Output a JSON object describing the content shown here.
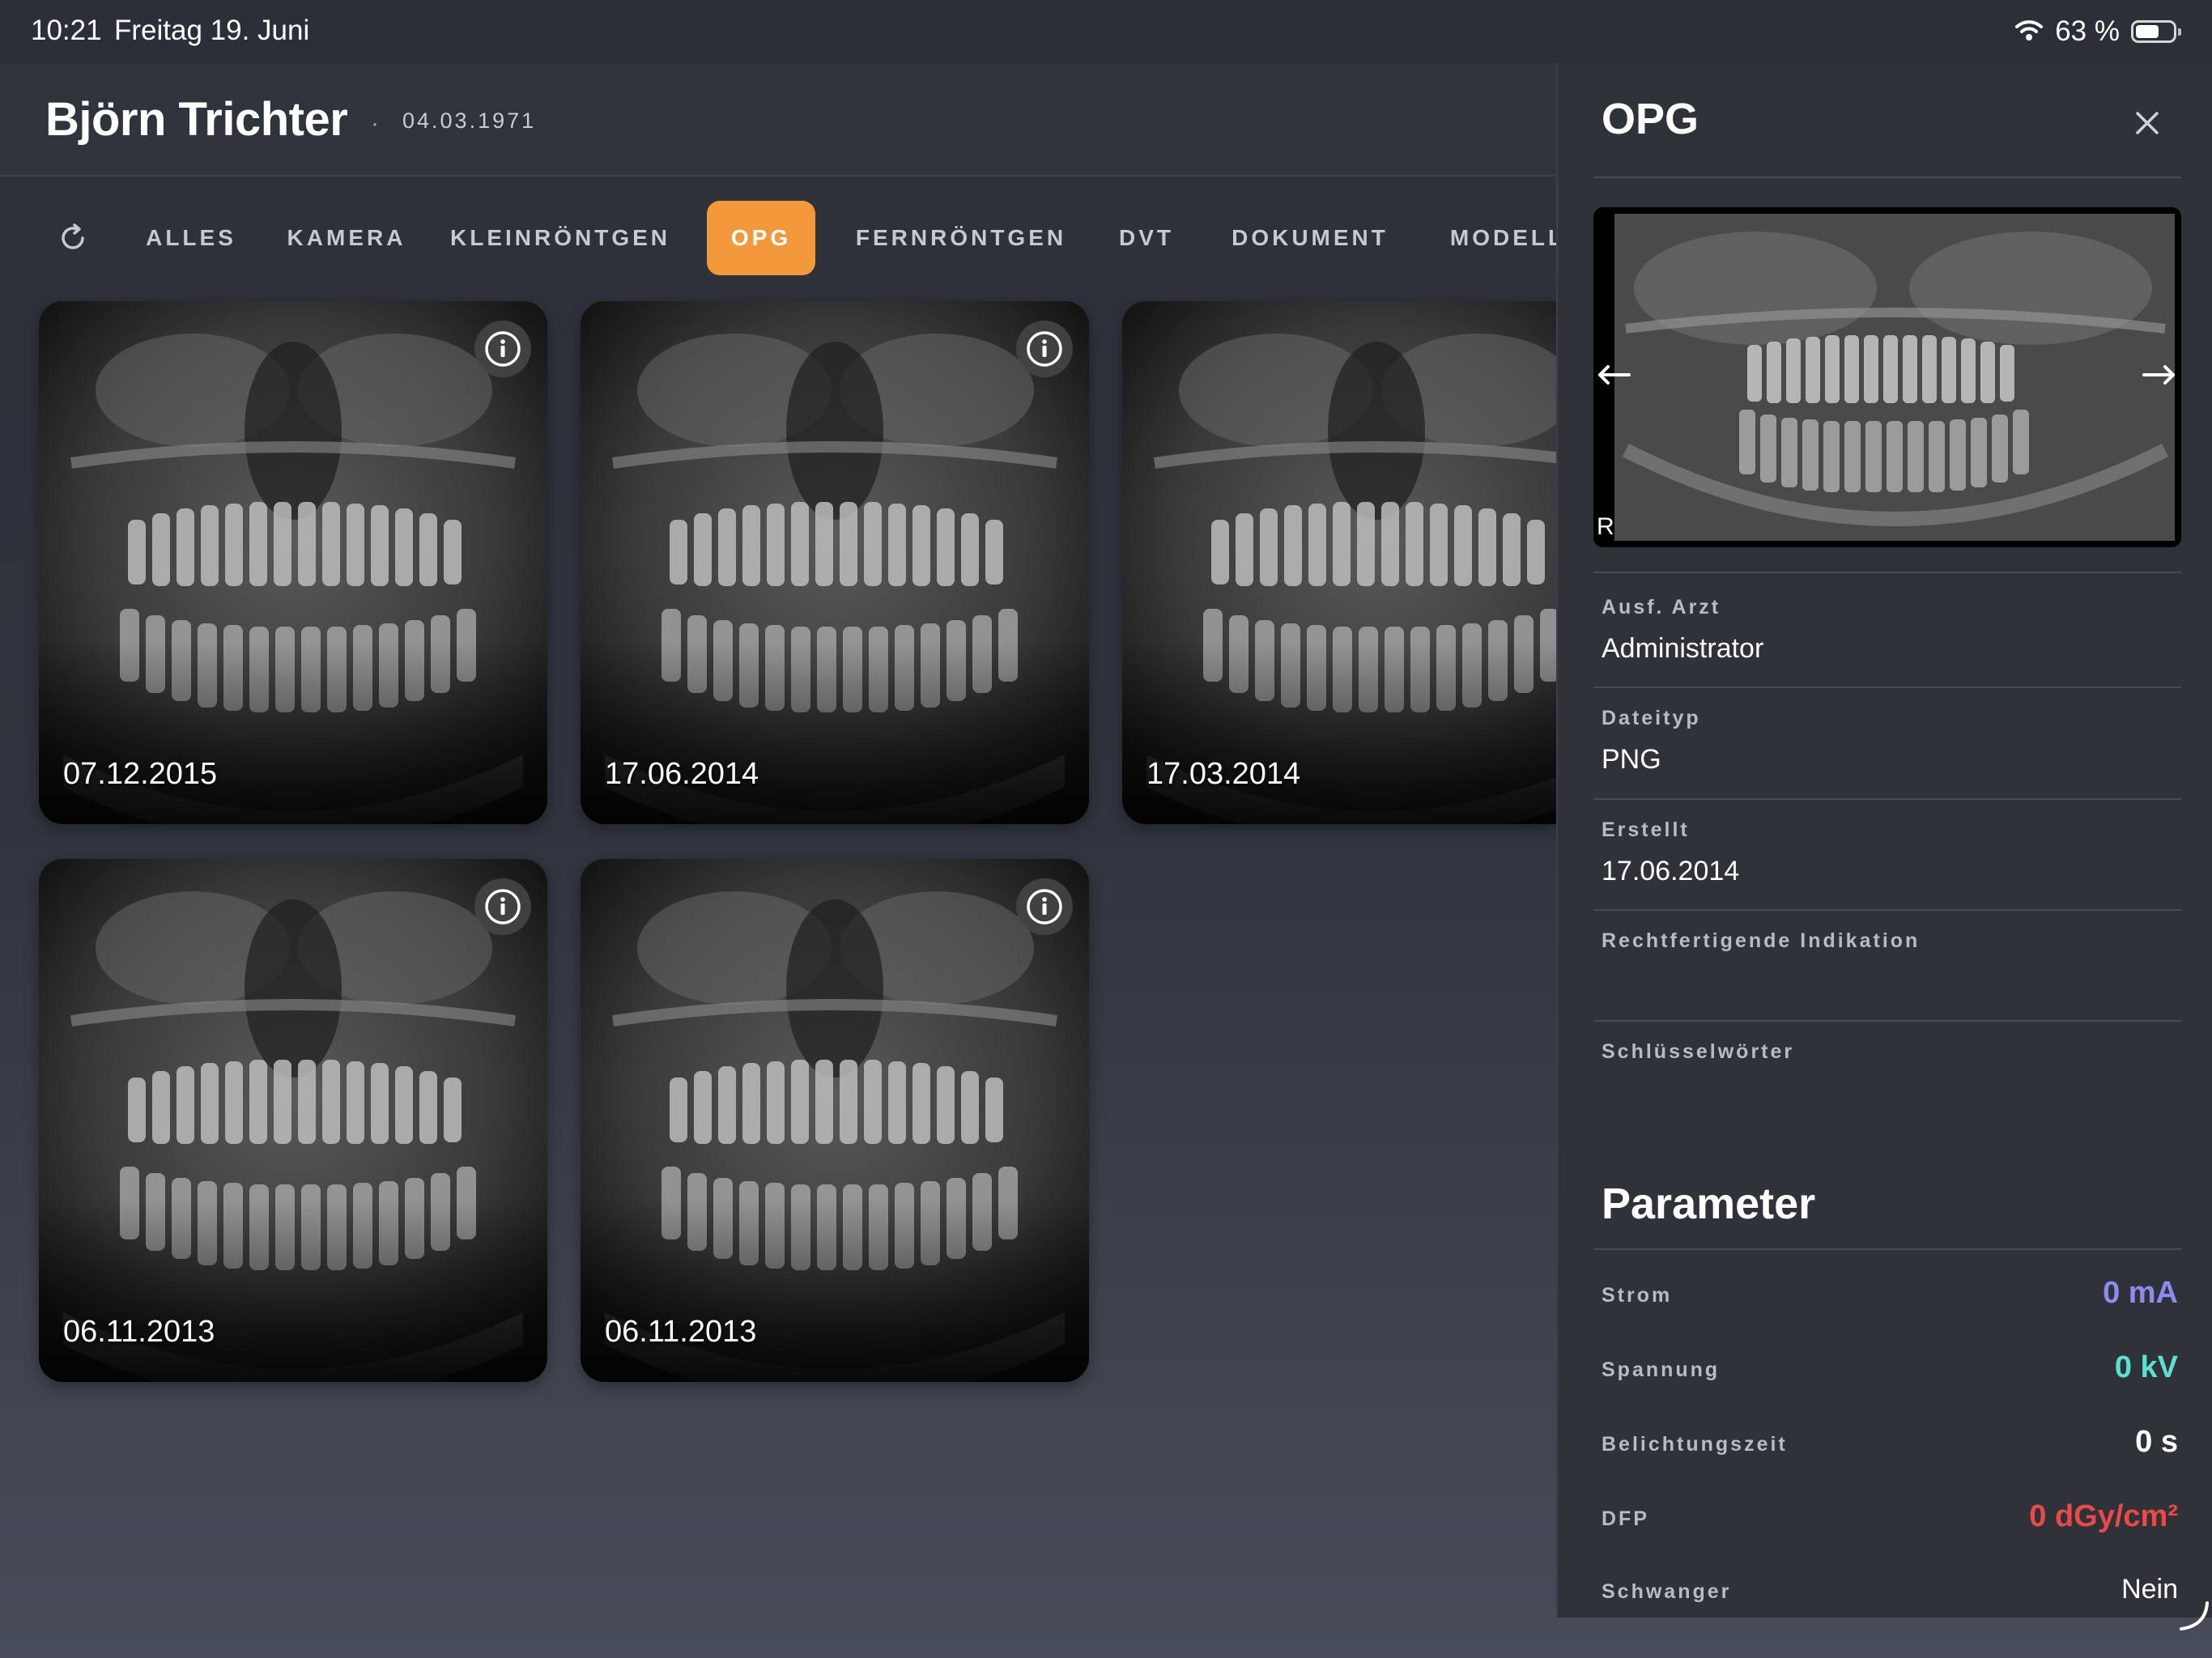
{
  "status_bar": {
    "time": "10:21",
    "date": "Freitag 19. Juni",
    "battery": "63 %",
    "battery_level": 0.63
  },
  "patient": {
    "name": "Björn Trichter",
    "separator": "·",
    "dob": "04.03.1971"
  },
  "tabs": [
    {
      "label": "ALLES",
      "active": false
    },
    {
      "label": "KAMERA",
      "active": false
    },
    {
      "label": "KLEINRÖNTGEN",
      "active": false
    },
    {
      "label": "OPG",
      "active": true
    },
    {
      "label": "FERNRÖNTGEN",
      "active": false
    },
    {
      "label": "DVT",
      "active": false
    },
    {
      "label": "DOKUMENT",
      "active": false
    },
    {
      "label": "MODELL",
      "active": false
    }
  ],
  "images": [
    {
      "date": "07.12.2015"
    },
    {
      "date": "17.06.2014"
    },
    {
      "date": "17.03.2014"
    },
    {
      "date": "06.11.2013"
    },
    {
      "date": "06.11.2013"
    }
  ],
  "panel": {
    "title": "OPG",
    "preview_marker": "R",
    "fields": [
      {
        "label": "Ausf. Arzt",
        "value": "Administrator"
      },
      {
        "label": "Dateityp",
        "value": "PNG"
      },
      {
        "label": "Erstellt",
        "value": "17.06.2014"
      },
      {
        "label": "Rechtfertigende Indikation",
        "value": ""
      },
      {
        "label": "Schlüsselwörter",
        "value": ""
      }
    ],
    "parameters_title": "Parameter",
    "parameters": [
      {
        "label": "Strom",
        "value": "0 mA",
        "color": "#8c8cf0"
      },
      {
        "label": "Spannung",
        "value": "0 kV",
        "color": "#5fe0cf"
      },
      {
        "label": "Belichtungszeit",
        "value": "0 s",
        "color": "#ffffff"
      },
      {
        "label": "DFP",
        "value": "0 dGy/cm²",
        "color": "#e84a4a"
      },
      {
        "label": "Schwanger",
        "value": "Nein",
        "color": "#ffffff"
      }
    ]
  },
  "colors": {
    "accent": "#f29a3b",
    "background": "#2c3039",
    "panel": "#2f3239"
  }
}
